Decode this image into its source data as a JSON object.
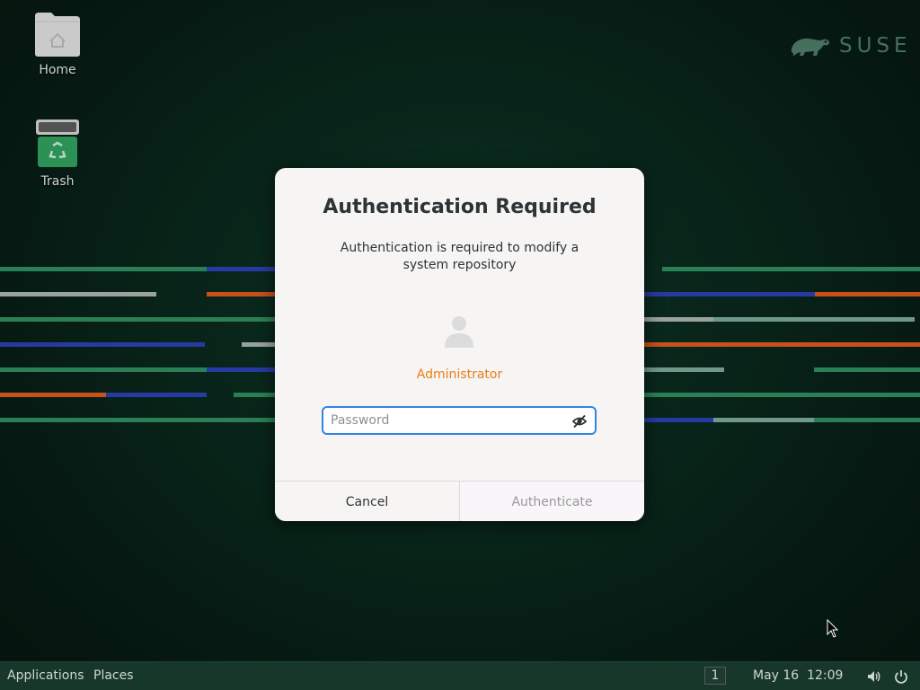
{
  "desktop": {
    "icons": [
      {
        "label": "Home"
      },
      {
        "label": "Trash"
      }
    ],
    "brand": "SUSE"
  },
  "dialog": {
    "title": "Authentication Required",
    "message": "Authentication is required to modify a system repository",
    "user": "Administrator",
    "password": {
      "placeholder": "Password",
      "value": ""
    },
    "buttons": {
      "cancel": "Cancel",
      "authenticate": "Authenticate"
    }
  },
  "taskbar": {
    "applications": "Applications",
    "places": "Places",
    "workspace": "1",
    "clock": "May 16  12:09"
  },
  "colors": {
    "accent": "#3584e4",
    "user_name": "#e87f16",
    "brand": "#4d7a66"
  }
}
